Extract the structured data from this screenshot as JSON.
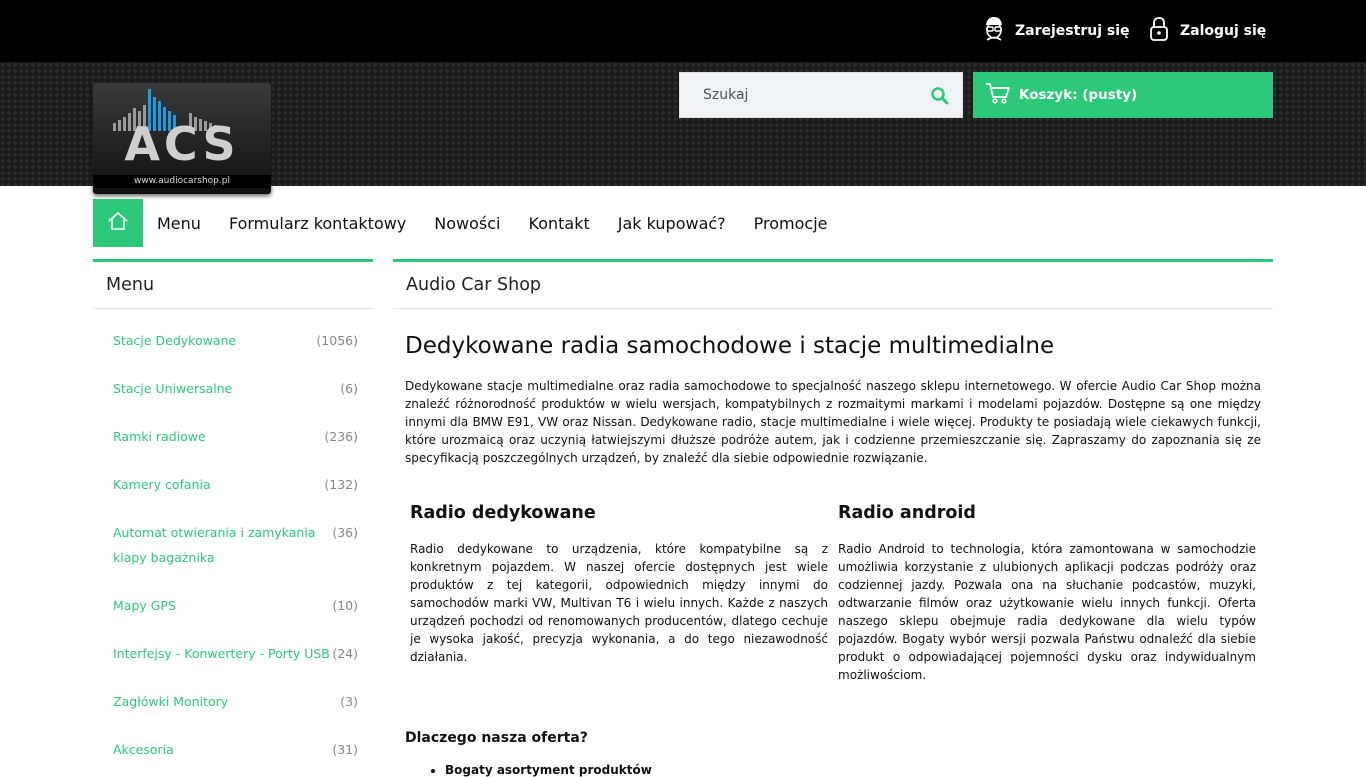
{
  "topbar": {
    "register_label": "Zarejestruj się",
    "login_label": "Zaloguj się"
  },
  "logo": {
    "text": "ACS",
    "url_text": "www.audiocarshop.pl"
  },
  "search": {
    "placeholder": "Szukaj"
  },
  "cart": {
    "label": "Koszyk: (pusty)"
  },
  "nav": {
    "items": [
      "Menu",
      "Formularz kontaktowy",
      "Nowości",
      "Kontakt",
      "Jak kupować?",
      "Promocje"
    ]
  },
  "sidebar": {
    "title": "Menu",
    "categories": [
      {
        "name": "Stacje Dedykowane",
        "count": "(1056)"
      },
      {
        "name": "Stacje Uniwersalne",
        "count": "(6)"
      },
      {
        "name": "Ramki radiowe",
        "count": "(236)"
      },
      {
        "name": "Kamery cofania",
        "count": "(132)"
      },
      {
        "name": "Automat otwierania i zamykania klapy bagażnika",
        "count": "(36)"
      },
      {
        "name": "Mapy GPS",
        "count": "(10)"
      },
      {
        "name": "Interfejsy - Konwertery - Porty USB",
        "count": "(24)"
      },
      {
        "name": "Zagłówki Monitory",
        "count": "(3)"
      },
      {
        "name": "Akcesoria",
        "count": "(31)"
      }
    ]
  },
  "main": {
    "box_title": "Audio Car Shop",
    "heading": "Dedykowane radia samochodowe i stacje multimedialne",
    "intro": "Dedykowane stacje multimedialne oraz radia samochodowe to specjalność naszego sklepu internetowego. W ofercie Audio Car Shop można znaleźć różnorodność produktów w wielu wersjach, kompatybilnych z rozmaitymi markami i modelami pojazdów. Dostępne są one między innymi dla BMW E91, VW oraz Nissan. Dedykowane radio, stacje multimedialne i wiele więcej. Produkty te posiadają wiele ciekawych funkcji, które urozmaicą oraz uczynią łatwiejszymi dłuższe podróże autem, jak i codzienne przemieszczanie się. Zapraszamy do zapoznania się ze specyfikacją poszczególnych urządzeń, by znaleźć dla siebie odpowiednie rozwiązanie.",
    "col1_title": "Radio dedykowane",
    "col1_text": "Radio dedykowane to urządzenia, które kompatybilne są z konkretnym pojazdem. W naszej ofercie dostępnych jest wiele produktów z tej kategorii, odpowiednich między innymi do samochodów marki VW, Multivan T6 i wielu innych. Każde z naszych urządzeń pochodzi od renomowanych producentów, dlatego cechuje je wysoka jakość, precyzja wykonania, a do tego niezawodność działania.",
    "col2_title": "Radio android",
    "col2_text": "Radio Android to technologia, która zamontowana w samochodzie umożliwia korzystanie z ulubionych aplikacji podczas podróży oraz codziennej jazdy. Pozwala ona na słuchanie podcastów, muzyki, odtwarzanie filmów oraz użytkowanie wielu innych funkcji. Oferta naszego sklepu obejmuje radia dedykowane dla wielu typów pojazdów. Bogaty wybór wersji pozwala Państwu odnaleźć dla siebie produkt o odpowiadającej pojemności dysku oraz indywidualnym możliwościom.",
    "why_title": "Dlaczego nasza oferta?",
    "bullet1": "Bogaty asortyment produktów"
  },
  "colors": {
    "accent": "#2ec87a",
    "topbar": "#000000"
  },
  "icons": [
    "user-icon",
    "lock-icon",
    "search-icon",
    "cart-icon",
    "home-icon"
  ]
}
